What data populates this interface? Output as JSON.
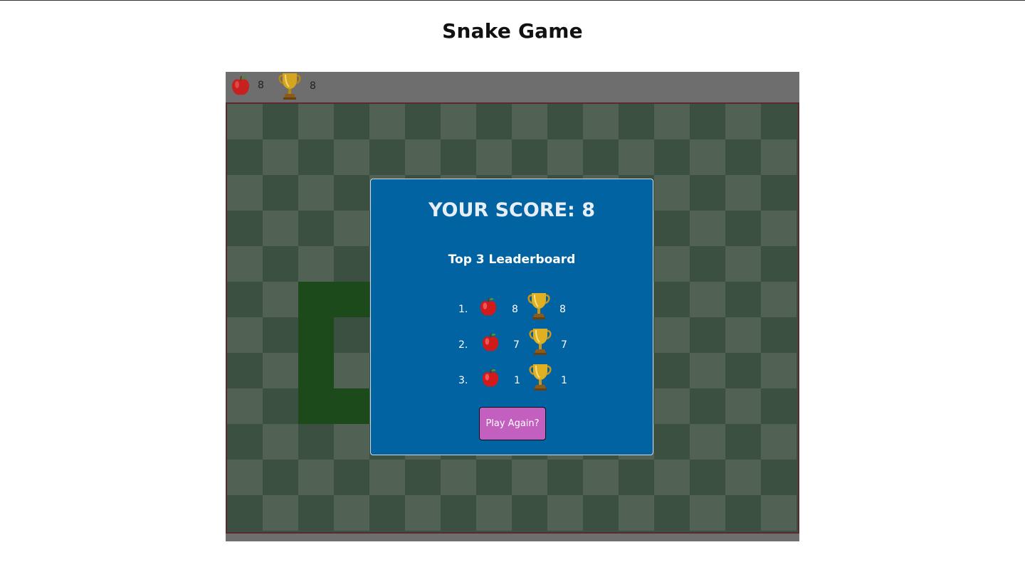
{
  "page": {
    "title": "Snake Game"
  },
  "hud": {
    "apple_icon": "apple-icon",
    "trophy_icon": "trophy-icon",
    "current_score": "8",
    "high_score": "8"
  },
  "board": {
    "columns": 16,
    "rows": 12,
    "snake_cells": [
      [
        2,
        5
      ],
      [
        3,
        5
      ],
      [
        2,
        6
      ],
      [
        2,
        7
      ],
      [
        2,
        8
      ],
      [
        3,
        8
      ]
    ]
  },
  "modal": {
    "score_text": "YOUR SCORE: 8",
    "leaderboard_title": "Top 3 Leaderboard",
    "leaderboard": [
      {
        "rank": "1.",
        "apples": "8",
        "trophies": "8"
      },
      {
        "rank": "2.",
        "apples": "7",
        "trophies": "7"
      },
      {
        "rank": "3.",
        "apples": "1",
        "trophies": "1"
      }
    ],
    "play_again_label": "Play Again?"
  },
  "colors": {
    "modal_bg": "#0263a2",
    "button_bg": "#c25fbf",
    "snake": "#1c4a1a",
    "cell_light": "#516255",
    "cell_dark": "#3c5042"
  }
}
